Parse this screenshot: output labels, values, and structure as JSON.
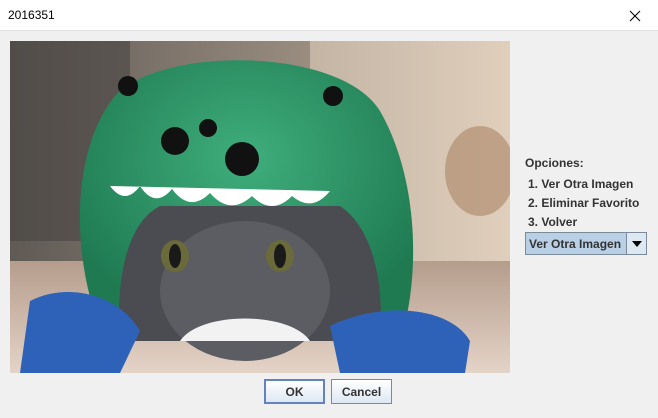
{
  "window": {
    "title": "2016351"
  },
  "image": {
    "alt": ""
  },
  "options": {
    "header": "Opciones:",
    "items": [
      "1. Ver Otra Imagen",
      "2. Eliminar Favorito",
      "3. Volver"
    ],
    "selected": "Ver Otra Imagen"
  },
  "buttons": {
    "ok": "OK",
    "cancel": "Cancel"
  },
  "colors": {
    "combo_bg": "#b8cfe5",
    "ok_border": "#6382bf"
  }
}
